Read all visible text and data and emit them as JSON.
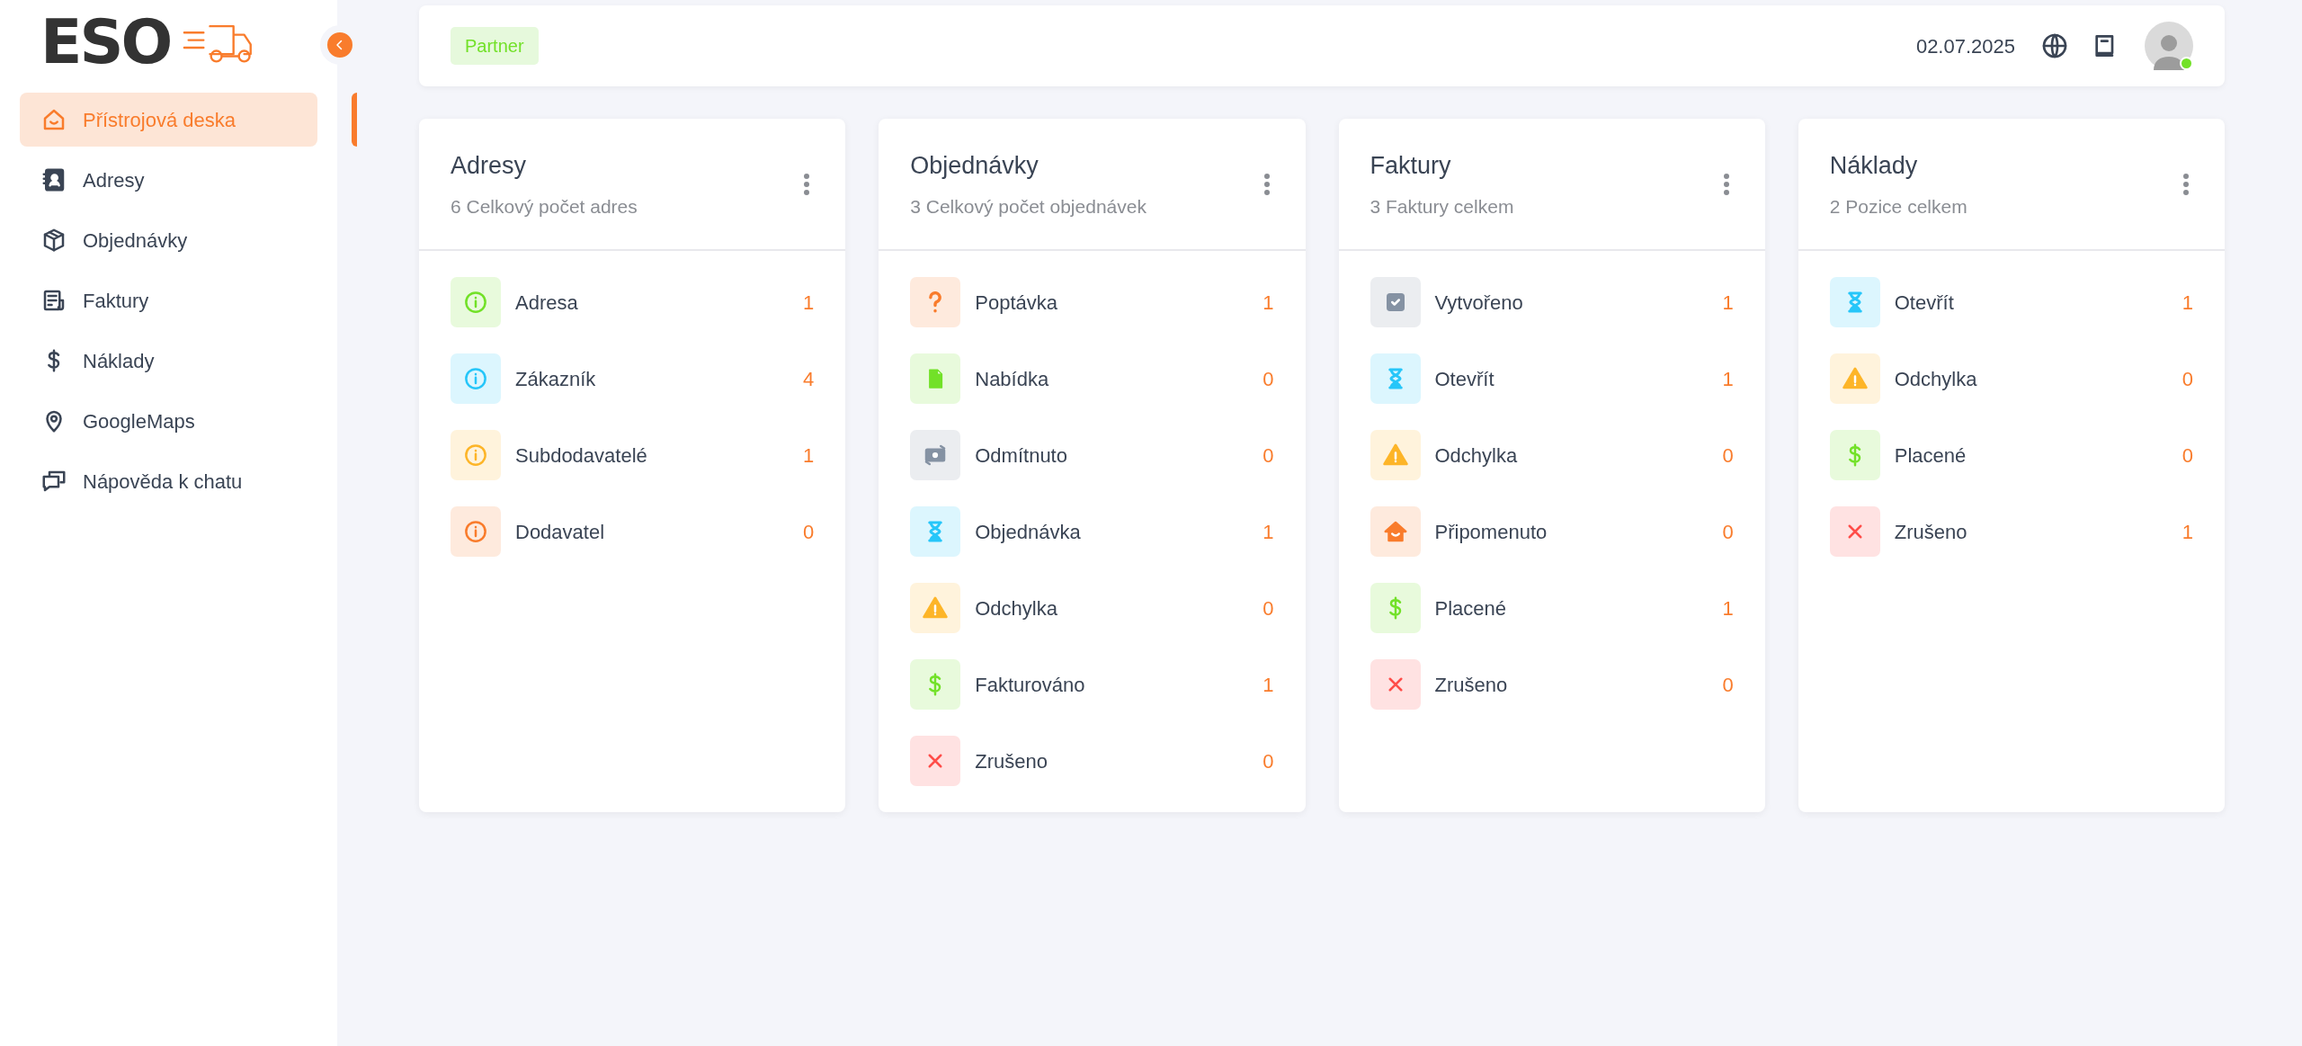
{
  "logo": {
    "text": "ESO"
  },
  "sidebar": {
    "items": [
      {
        "label": "Přístrojová deska",
        "kind": "home",
        "selected": true
      },
      {
        "label": "Adresy",
        "kind": "contacts",
        "selected": false
      },
      {
        "label": "Objednávky",
        "kind": "box",
        "selected": false
      },
      {
        "label": "Faktury",
        "kind": "invoice",
        "selected": false
      },
      {
        "label": "Náklady",
        "kind": "dollar",
        "selected": false
      },
      {
        "label": "GoogleMaps",
        "kind": "pin",
        "selected": false
      },
      {
        "label": "Nápověda k chatu",
        "kind": "chat",
        "selected": false
      }
    ]
  },
  "header": {
    "badge": "Partner",
    "date": "02.07.2025",
    "user": {
      "online": true
    }
  },
  "cards": [
    {
      "title": "Adresy",
      "subtitle": "6 Celkový počet adres",
      "rows": [
        {
          "label": "Adresa",
          "count": "1",
          "kind": "info",
          "color": "#72e128"
        },
        {
          "label": "Zákazník",
          "count": "4",
          "kind": "info",
          "color": "#26c6f9"
        },
        {
          "label": "Subdodavatelé",
          "count": "1",
          "kind": "info",
          "color": "#fdb528"
        },
        {
          "label": "Dodavatel",
          "count": "0",
          "kind": "info",
          "color": "#f97c2c"
        }
      ]
    },
    {
      "title": "Objednávky",
      "subtitle": "3 Celkový počet objednávek",
      "rows": [
        {
          "label": "Poptávka",
          "count": "1",
          "kind": "question",
          "color": "#f97c2c"
        },
        {
          "label": "Nabídka",
          "count": "0",
          "kind": "file",
          "color": "#72e128"
        },
        {
          "label": "Odmítnuto",
          "count": "0",
          "kind": "money",
          "color": "#8592a3"
        },
        {
          "label": "Objednávka",
          "count": "1",
          "kind": "hourglass",
          "color": "#26c6f9"
        },
        {
          "label": "Odchylka",
          "count": "0",
          "kind": "warning",
          "color": "#fdb528"
        },
        {
          "label": "Fakturováno",
          "count": "1",
          "kind": "dollar",
          "color": "#72e128"
        },
        {
          "label": "Zrušeno",
          "count": "0",
          "kind": "cross",
          "color": "#ff4d49"
        }
      ]
    },
    {
      "title": "Faktury",
      "subtitle": "3 Faktury celkem",
      "rows": [
        {
          "label": "Vytvořeno",
          "count": "1",
          "kind": "check",
          "color": "#8592a3"
        },
        {
          "label": "Otevřít",
          "count": "1",
          "kind": "hourglass",
          "color": "#26c6f9"
        },
        {
          "label": "Odchylka",
          "count": "0",
          "kind": "warning",
          "color": "#fdb528"
        },
        {
          "label": "Připomenuto",
          "count": "0",
          "kind": "homefill",
          "color": "#f97c2c"
        },
        {
          "label": "Placené",
          "count": "1",
          "kind": "dollar",
          "color": "#72e128"
        },
        {
          "label": "Zrušeno",
          "count": "0",
          "kind": "cross",
          "color": "#ff4d49"
        }
      ]
    },
    {
      "title": "Náklady",
      "subtitle": "2 Pozice celkem",
      "rows": [
        {
          "label": "Otevřít",
          "count": "1",
          "kind": "hourglass",
          "color": "#26c6f9"
        },
        {
          "label": "Odchylka",
          "count": "0",
          "kind": "warning",
          "color": "#fdb528"
        },
        {
          "label": "Placené",
          "count": "0",
          "kind": "dollar",
          "color": "#72e128"
        },
        {
          "label": "Zrušeno",
          "count": "1",
          "kind": "cross",
          "color": "#ff4d49"
        }
      ]
    }
  ]
}
